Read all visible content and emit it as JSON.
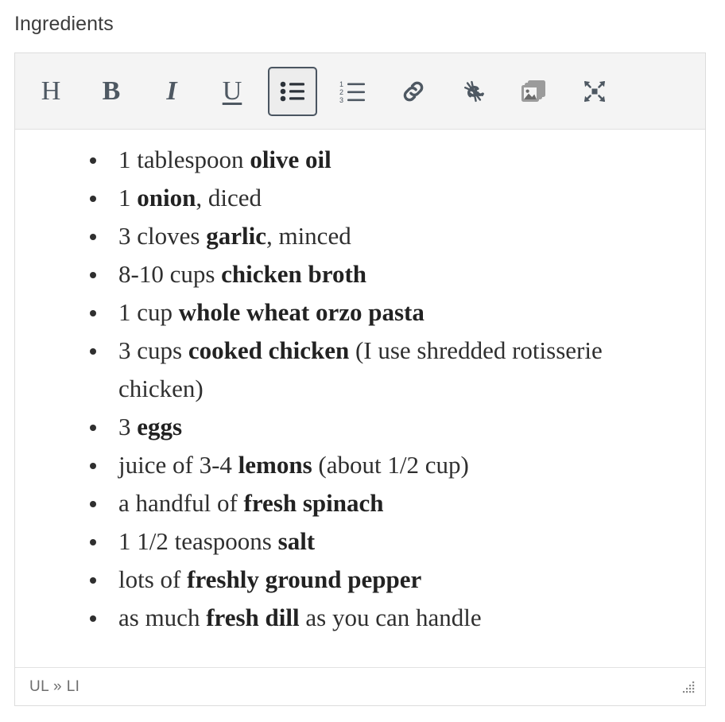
{
  "field": {
    "label": "Ingredients"
  },
  "toolbar": {
    "buttons": [
      {
        "name": "heading-button",
        "icon": "heading-icon",
        "label": "H",
        "active": false
      },
      {
        "name": "bold-button",
        "icon": "bold-icon",
        "label": "B",
        "active": false
      },
      {
        "name": "italic-button",
        "icon": "italic-icon",
        "label": "I",
        "active": false
      },
      {
        "name": "underline-button",
        "icon": "underline-icon",
        "label": "U",
        "active": false
      },
      {
        "name": "bullet-list-button",
        "icon": "bullet-list-icon",
        "label": "",
        "active": true
      },
      {
        "name": "numbered-list-button",
        "icon": "numbered-list-icon",
        "label": "",
        "active": false
      },
      {
        "name": "insert-link-button",
        "icon": "link-icon",
        "label": "",
        "active": false
      },
      {
        "name": "remove-link-button",
        "icon": "unlink-icon",
        "label": "",
        "active": false
      },
      {
        "name": "insert-image-button",
        "icon": "image-gallery-icon",
        "label": "",
        "active": false
      },
      {
        "name": "fullscreen-button",
        "icon": "fullscreen-icon",
        "label": "",
        "active": false
      }
    ],
    "ordered_list_numbers": [
      "1",
      "2",
      "3"
    ]
  },
  "content": {
    "list_type": "bullet",
    "items": [
      {
        "id": "olive-oil",
        "prefix": "1 tablespoon ",
        "bold": "olive oil",
        "suffix": ""
      },
      {
        "id": "onion",
        "prefix": "1 ",
        "bold": "onion",
        "suffix": ", diced"
      },
      {
        "id": "garlic",
        "prefix": "3 cloves ",
        "bold": "garlic",
        "suffix": ", minced"
      },
      {
        "id": "chicken-broth",
        "prefix": "8-10 cups ",
        "bold": "chicken broth",
        "suffix": ""
      },
      {
        "id": "orzo-pasta",
        "prefix": "1 cup ",
        "bold": "whole wheat orzo pasta",
        "suffix": ""
      },
      {
        "id": "cooked-chicken",
        "prefix": "3 cups ",
        "bold": "cooked chicken",
        "suffix": " (I use shredded rotisserie chicken)"
      },
      {
        "id": "eggs",
        "prefix": "3 ",
        "bold": "eggs",
        "suffix": ""
      },
      {
        "id": "lemons",
        "prefix": "juice of 3-4 ",
        "bold": "lemons",
        "suffix": " (about 1/2 cup)"
      },
      {
        "id": "fresh-spinach",
        "prefix": "a handful of ",
        "bold": "fresh spinach",
        "suffix": ""
      },
      {
        "id": "salt",
        "prefix": "1 1/2 teaspoons ",
        "bold": "salt",
        "suffix": ""
      },
      {
        "id": "pepper",
        "prefix": "lots of ",
        "bold": "freshly ground pepper",
        "suffix": ""
      },
      {
        "id": "fresh-dill",
        "prefix": "as much ",
        "bold": "fresh dill",
        "suffix": " as you can handle"
      }
    ]
  },
  "statusbar": {
    "element_path": "UL » LI",
    "resize_handle_icon": "resize-grip-icon"
  },
  "colors": {
    "toolbar_background": "#f4f4f4",
    "toolbar_icon": "#4e5862",
    "toolbar_icon_muted": "#9b9b9b",
    "active_button_border": "#4a5561",
    "editor_border": "#dcdcdc",
    "body_text": "#2f2f2f",
    "label_text": "#3c3c3c",
    "status_text": "#6e6e6e"
  }
}
